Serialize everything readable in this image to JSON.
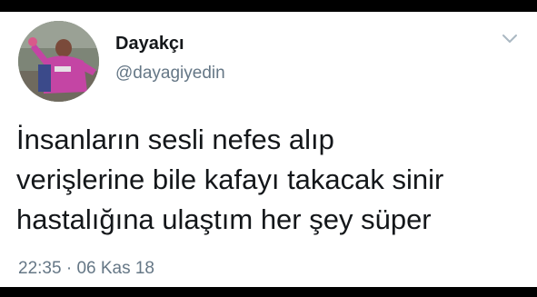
{
  "author": {
    "display_name": "Dayakçı",
    "handle": "@dayagiyedin",
    "avatar_icon": "profile-photo"
  },
  "tweet": {
    "lines": [
      "İnsanların sesli nefes alıp",
      "verişlerine bile kafayı takacak sinir",
      "hastalığına ulaştım her şey süper"
    ],
    "time": "22:35",
    "separator": "·",
    "date": "06 Kas 18"
  },
  "menu": {
    "icon": "chevron-down-icon"
  },
  "colors": {
    "background": "#ffffff",
    "text_primary": "#14171a",
    "text_secondary": "#657786",
    "frame": "#000000"
  }
}
